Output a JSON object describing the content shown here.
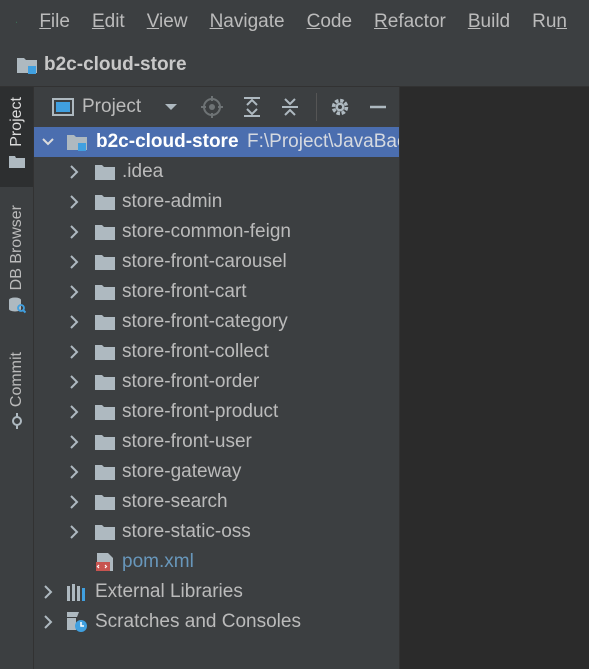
{
  "menu": {
    "items": [
      {
        "mnemonic": "F",
        "rest": "ile"
      },
      {
        "mnemonic": "E",
        "rest": "dit"
      },
      {
        "mnemonic": "V",
        "rest": "iew"
      },
      {
        "mnemonic": "N",
        "rest": "avigate"
      },
      {
        "mnemonic": "C",
        "rest": "ode"
      },
      {
        "mnemonic": "R",
        "rest": "efactor"
      },
      {
        "mnemonic": "B",
        "rest": "uild"
      },
      {
        "mnemonic": "R",
        "rest": "u",
        "tail": "n"
      }
    ]
  },
  "navbar": {
    "project_name": "b2c-cloud-store"
  },
  "toolstrip": {
    "project_label": "Project",
    "db_browser_label": "DB Browser",
    "commit_label": "Commit"
  },
  "panel": {
    "title": "Project",
    "tree": {
      "root_name": "b2c-cloud-store",
      "root_path": "F:\\Project\\JavaBac",
      "modules": [
        ".idea",
        "store-admin",
        "store-common-feign",
        "store-front-carousel",
        "store-front-cart",
        "store-front-category",
        "store-front-collect",
        "store-front-order",
        "store-front-product",
        "store-front-user",
        "store-gateway",
        "store-search",
        "store-static-oss"
      ],
      "pom_file": "pom.xml",
      "external_libraries": "External Libraries",
      "scratches": "Scratches and Consoles"
    }
  },
  "colors": {
    "menubar_bg": "#3c3f41",
    "editor_bg": "#2b2b2b",
    "selection": "#4b6eaf",
    "folder": "#aeb9c0",
    "android_green": "#3ddc84",
    "pom_link": "#6897bb"
  }
}
